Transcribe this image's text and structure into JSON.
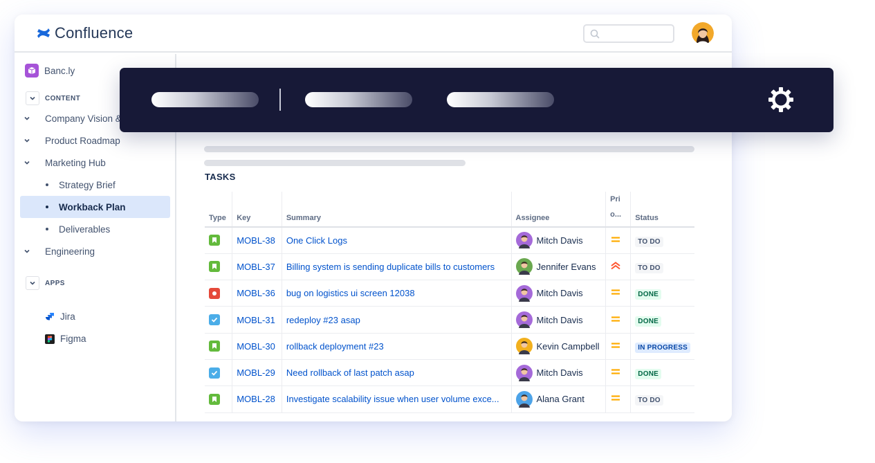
{
  "app": {
    "name": "Confluence",
    "brand_color": "#1868db"
  },
  "search": {
    "placeholder": ""
  },
  "sidebar": {
    "space_name": "Banc.ly",
    "content_label": "CONTENT",
    "items": [
      {
        "label": "Company Vision & Values",
        "kind": "parent"
      },
      {
        "label": "Product Roadmap",
        "kind": "parent"
      },
      {
        "label": "Marketing Hub",
        "kind": "parent"
      },
      {
        "label": "Strategy Brief",
        "kind": "child"
      },
      {
        "label": "Workback Plan",
        "kind": "child",
        "selected": true
      },
      {
        "label": "Deliverables",
        "kind": "child"
      },
      {
        "label": "Engineering",
        "kind": "parent"
      }
    ],
    "apps_label": "APPS",
    "apps": [
      {
        "label": "Jira",
        "icon": "jira-icon"
      },
      {
        "label": "Figma",
        "icon": "figma-icon"
      }
    ]
  },
  "main": {
    "tasks_title": "TASKS",
    "columns": {
      "type": "Type",
      "key": "Key",
      "summary": "Summary",
      "assignee": "Assignee",
      "priority": "Pri o...",
      "status": "Status"
    },
    "rows": [
      {
        "type": "story",
        "key": "MOBL-38",
        "summary": "One Click Logs",
        "assignee": "Mitch Davis",
        "avatar_color": "#a56ad9",
        "priority": "medium",
        "status": "TO DO"
      },
      {
        "type": "story",
        "key": "MOBL-37",
        "summary": "Billing system is sending duplicate bills to customers",
        "assignee": "Jennifer Evans",
        "avatar_color": "#6aa84f",
        "priority": "high",
        "status": "TO DO"
      },
      {
        "type": "bug",
        "key": "MOBL-36",
        "summary": "bug on logistics ui screen 12038",
        "assignee": "Mitch Davis",
        "avatar_color": "#a56ad9",
        "priority": "medium",
        "status": "DONE"
      },
      {
        "type": "task",
        "key": "MOBL-31",
        "summary": "redeploy #23 asap",
        "assignee": "Mitch Davis",
        "avatar_color": "#a56ad9",
        "priority": "medium",
        "status": "DONE"
      },
      {
        "type": "story",
        "key": "MOBL-30",
        "summary": "rollback deployment #23",
        "assignee": "Kevin Campbell",
        "avatar_color": "#f2b01e",
        "priority": "medium",
        "status": "IN PROGRESS"
      },
      {
        "type": "task",
        "key": "MOBL-29",
        "summary": "Need rollback of last patch asap",
        "assignee": "Mitch Davis",
        "avatar_color": "#a56ad9",
        "priority": "medium",
        "status": "DONE"
      },
      {
        "type": "story",
        "key": "MOBL-28",
        "summary": "Investigate scalability issue when user volume exce...",
        "assignee": "Alana Grant",
        "avatar_color": "#4da3e8",
        "priority": "medium",
        "status": "TO DO"
      }
    ]
  },
  "overlay": {
    "background": "#171937",
    "icon": "gear-icon"
  }
}
